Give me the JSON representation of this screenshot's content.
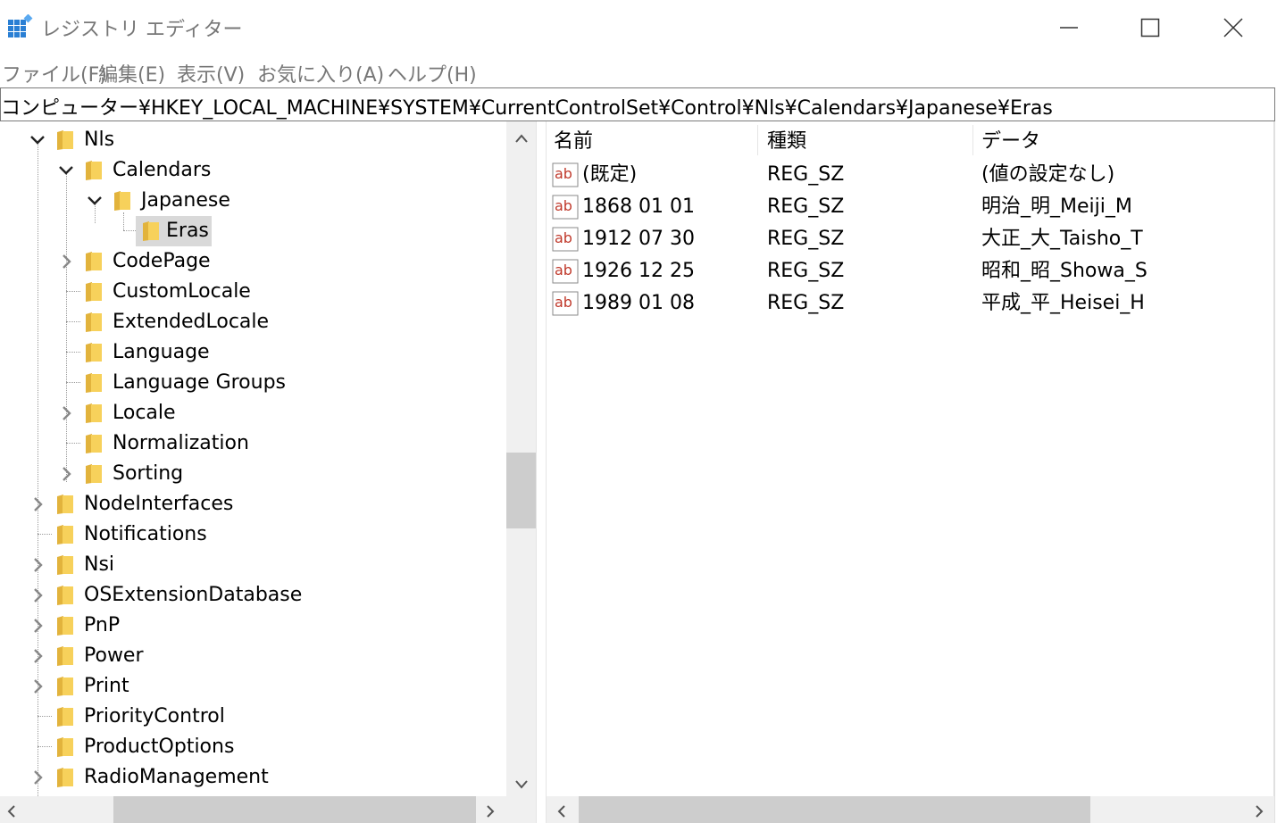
{
  "window": {
    "title": "レジストリ エディター"
  },
  "menu": [
    "ファイル(F)",
    "編集(E)",
    "表示(V)",
    "お気に入り(A)",
    "ヘルプ(H)"
  ],
  "address": "コンピューター¥HKEY_LOCAL_MACHINE¥SYSTEM¥CurrentControlSet¥Control¥Nls¥Calendars¥Japanese¥Eras",
  "tree": [
    {
      "label": "Nls",
      "state": "expanded"
    },
    {
      "label": "Calendars",
      "state": "expanded"
    },
    {
      "label": "Japanese",
      "state": "expanded"
    },
    {
      "label": "Eras",
      "state": "selected"
    },
    {
      "label": "CodePage",
      "state": "collapsed"
    },
    {
      "label": "CustomLocale",
      "state": "leaf"
    },
    {
      "label": "ExtendedLocale",
      "state": "leaf"
    },
    {
      "label": "Language",
      "state": "leaf"
    },
    {
      "label": "Language Groups",
      "state": "leaf"
    },
    {
      "label": "Locale",
      "state": "collapsed"
    },
    {
      "label": "Normalization",
      "state": "leaf"
    },
    {
      "label": "Sorting",
      "state": "collapsed"
    },
    {
      "label": "NodeInterfaces",
      "state": "collapsed"
    },
    {
      "label": "Notifications",
      "state": "leaf"
    },
    {
      "label": "Nsi",
      "state": "collapsed"
    },
    {
      "label": "OSExtensionDatabase",
      "state": "collapsed"
    },
    {
      "label": "PnP",
      "state": "collapsed"
    },
    {
      "label": "Power",
      "state": "collapsed"
    },
    {
      "label": "Print",
      "state": "collapsed"
    },
    {
      "label": "PriorityControl",
      "state": "leaf"
    },
    {
      "label": "ProductOptions",
      "state": "leaf"
    },
    {
      "label": "RadioManagement",
      "state": "collapsed"
    }
  ],
  "list": {
    "headers": {
      "name": "名前",
      "type": "種類",
      "data": "データ"
    },
    "rows": [
      {
        "name": "(既定)",
        "type": "REG_SZ",
        "data": "(値の設定なし)"
      },
      {
        "name": "1868 01 01",
        "type": "REG_SZ",
        "data": "明治_明_Meiji_M"
      },
      {
        "name": "1912 07 30",
        "type": "REG_SZ",
        "data": "大正_大_Taisho_T"
      },
      {
        "name": "1926 12 25",
        "type": "REG_SZ",
        "data": "昭和_昭_Showa_S"
      },
      {
        "name": "1989 01 08",
        "type": "REG_SZ",
        "data": "平成_平_Heisei_H"
      }
    ]
  },
  "colors": {
    "folder": "#f7d15b",
    "folder_dark": "#e2b33c",
    "selection": "#d9d9d9",
    "regsz_icon": "#c0392b"
  }
}
